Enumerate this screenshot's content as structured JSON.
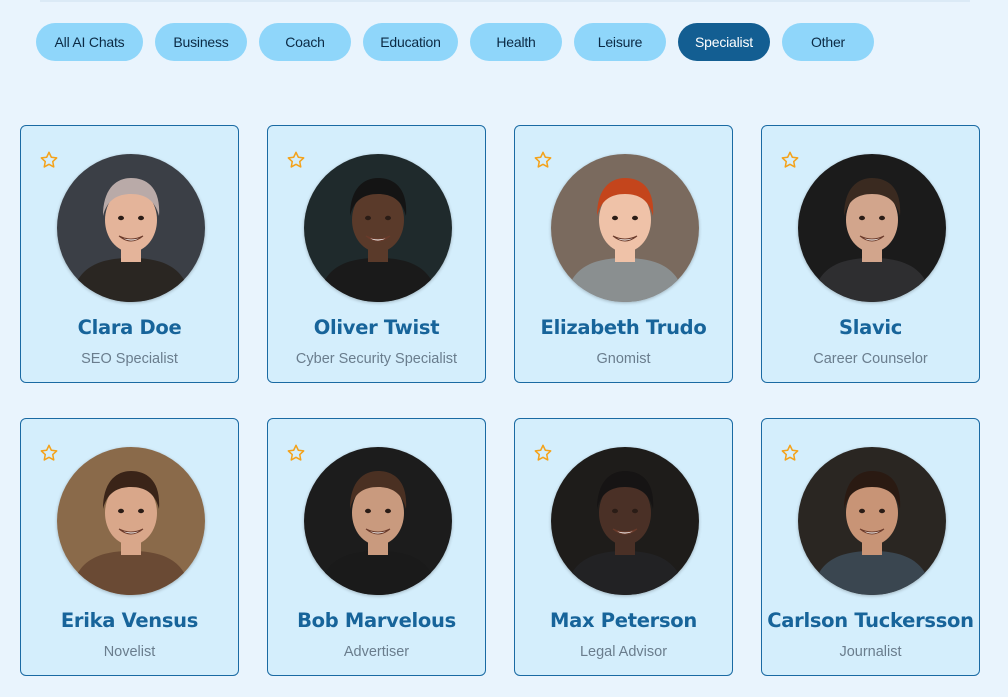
{
  "filters": [
    {
      "label": "All AI Chats",
      "active": false
    },
    {
      "label": "Business",
      "active": false
    },
    {
      "label": "Coach",
      "active": false
    },
    {
      "label": "Education",
      "active": false
    },
    {
      "label": "Health",
      "active": false
    },
    {
      "label": "Leisure",
      "active": false
    },
    {
      "label": "Specialist",
      "active": true
    },
    {
      "label": "Other",
      "active": false
    }
  ],
  "colors": {
    "background": "#e9f4fd",
    "chip": "#8fd6fa",
    "chip_active": "#135e92",
    "card": "#d4eefc",
    "card_border": "#1a6aa3",
    "name": "#17649a",
    "role": "#6a7d8d",
    "star": "#f4a21a"
  },
  "experts": [
    {
      "name": "Clara Doe",
      "role": "SEO Specialist",
      "favorite_icon": "star-outline-icon",
      "avatar": {
        "bg": "#3b3f46",
        "skin": "#e4b49a",
        "hair": "#b9aaa8",
        "shirt": "#2a2622"
      }
    },
    {
      "name": "Oliver Twist",
      "role": "Cyber Security Specialist",
      "favorite_icon": "star-outline-icon",
      "avatar": {
        "bg": "#1f2a2c",
        "skin": "#5a3a2a",
        "hair": "#141414",
        "shirt": "#1a1a1a"
      }
    },
    {
      "name": "Elizabeth Trudo",
      "role": "Gnomist",
      "favorite_icon": "star-outline-icon",
      "avatar": {
        "bg": "#7a6a5e",
        "skin": "#efc2a8",
        "hair": "#c4451c",
        "shirt": "#8a8f90"
      }
    },
    {
      "name": "Slavic",
      "role": "Career Counselor",
      "favorite_icon": "star-outline-icon",
      "avatar": {
        "bg": "#1b1b1b",
        "skin": "#d2a58c",
        "hair": "#3a2a20",
        "shirt": "#2e2e30"
      }
    },
    {
      "name": "Erika Vensus",
      "role": "Novelist",
      "favorite_icon": "star-outline-icon",
      "avatar": {
        "bg": "#8a6a4a",
        "skin": "#d9a78a",
        "hair": "#3a2418",
        "shirt": "#6a4a34"
      }
    },
    {
      "name": "Bob Marvelous",
      "role": "Advertiser",
      "favorite_icon": "star-outline-icon",
      "avatar": {
        "bg": "#1c1c1c",
        "skin": "#c99a7e",
        "hair": "#4a3022",
        "shirt": "#1a1a1a"
      }
    },
    {
      "name": "Max Peterson",
      "role": "Legal Advisor",
      "favorite_icon": "star-outline-icon",
      "avatar": {
        "bg": "#1e1c1a",
        "skin": "#4a3026",
        "hair": "#161414",
        "shirt": "#222224"
      }
    },
    {
      "name": "Carlson Tuckersson",
      "role": "Journalist",
      "favorite_icon": "star-outline-icon",
      "avatar": {
        "bg": "#2a2622",
        "skin": "#c89476",
        "hair": "#2a1a12",
        "shirt": "#3a4650"
      }
    }
  ]
}
